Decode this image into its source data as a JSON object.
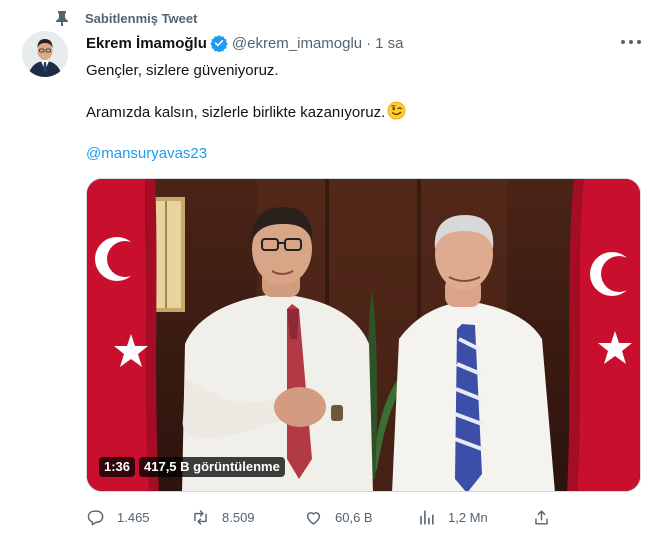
{
  "pinned": {
    "label": "Sabitlenmiş Tweet",
    "icon": "pin-icon"
  },
  "author": {
    "name": "Ekrem İmamoğlu",
    "handle": "@ekrem_imamoglu",
    "separator": "·",
    "time": "1 sa",
    "verified_color": "#1d9bf0"
  },
  "tweet": {
    "line1": "Gençler, sizlere güveniyoruz.",
    "line2": "Aramızda kalsın, sizlerle birlikte kazanıyoruz.",
    "emoji": "winking-face",
    "mention": "@mansuryavas23",
    "mention_color": "#1d9bf0"
  },
  "video": {
    "duration": "1:36",
    "views": "417,5 B görüntülenme"
  },
  "actions": {
    "replies": "1.465",
    "retweets": "8.509",
    "likes": "60,6 B",
    "views": "1,2 Mn"
  },
  "colors": {
    "text": "#0f1419",
    "secondary": "#536471",
    "flag_red": "#c8102e"
  }
}
